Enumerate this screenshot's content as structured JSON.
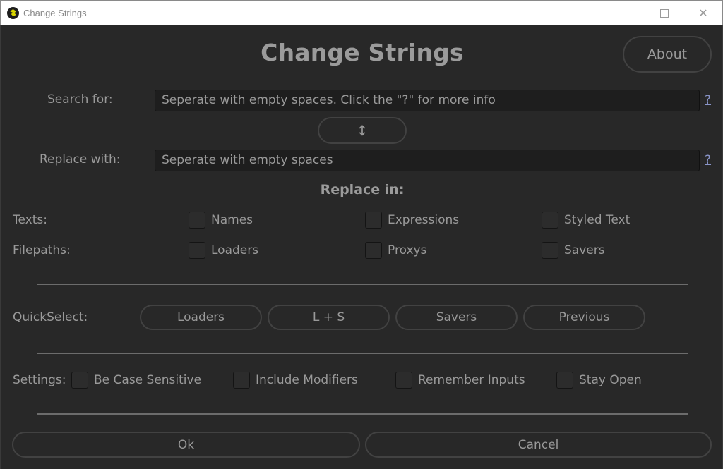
{
  "window": {
    "title": "Change Strings",
    "icon": "app-logo-icon",
    "controls": [
      "minimize-icon",
      "maximize-icon",
      "close-icon"
    ]
  },
  "header": {
    "title": "Change Strings",
    "about_label": "About"
  },
  "search": {
    "label": "Search for:",
    "placeholder": "Seperate with empty spaces. Click the \"?\" for more info",
    "value": "",
    "help_label": "?"
  },
  "swap": {
    "icon": "swap-vertical-icon",
    "glyph": "↕"
  },
  "replace": {
    "label": "Replace with:",
    "placeholder": "Seperate with empty spaces",
    "value": "",
    "help_label": "?"
  },
  "replace_in": {
    "title": "Replace in:",
    "rows": [
      {
        "label": "Texts:",
        "options": [
          {
            "label": "Names",
            "checked": false
          },
          {
            "label": "Expressions",
            "checked": false
          },
          {
            "label": "Styled Text",
            "checked": false
          }
        ]
      },
      {
        "label": "Filepaths:",
        "options": [
          {
            "label": "Loaders",
            "checked": false
          },
          {
            "label": "Proxys",
            "checked": false
          },
          {
            "label": "Savers",
            "checked": false
          }
        ]
      }
    ]
  },
  "quickselect": {
    "label": "QuickSelect:",
    "buttons": [
      "Loaders",
      "L + S",
      "Savers",
      "Previous"
    ]
  },
  "settings": {
    "label": "Settings:",
    "options": [
      {
        "label": "Be Case Sensitive",
        "checked": false
      },
      {
        "label": "Include Modifiers",
        "checked": false
      },
      {
        "label": "Remember Inputs",
        "checked": false
      },
      {
        "label": "Stay Open",
        "checked": false
      }
    ]
  },
  "footer": {
    "ok_label": "Ok",
    "cancel_label": "Cancel"
  }
}
